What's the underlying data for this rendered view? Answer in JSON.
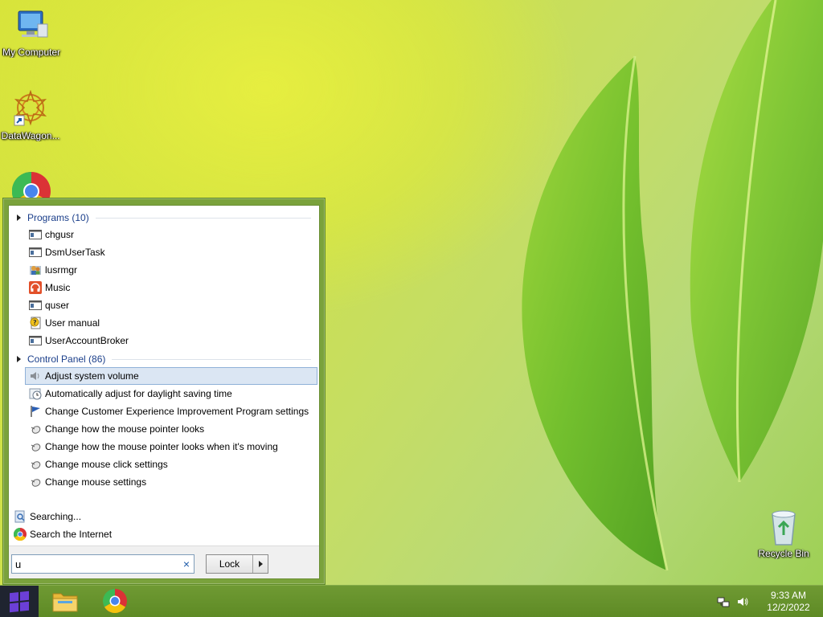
{
  "desktop": {
    "icons": [
      {
        "label": "My Computer",
        "icon": "computer-icon"
      },
      {
        "label": "DataWagon...",
        "icon": "datawagon-shortcut-icon"
      },
      {
        "label": "",
        "icon": "chrome-icon"
      },
      {
        "label": "Recycle Bin",
        "icon": "recycle-bin-icon"
      }
    ]
  },
  "start_menu": {
    "programs_header": "Programs (10)",
    "programs": [
      {
        "label": "chgusr",
        "icon": "console-app-icon"
      },
      {
        "label": "DsmUserTask",
        "icon": "console-app-icon"
      },
      {
        "label": "lusrmgr",
        "icon": "users-manager-icon"
      },
      {
        "label": "Music",
        "icon": "headphones-icon"
      },
      {
        "label": "quser",
        "icon": "console-app-icon"
      },
      {
        "label": "User manual",
        "icon": "help-document-icon"
      },
      {
        "label": "UserAccountBroker",
        "icon": "console-app-icon"
      }
    ],
    "control_panel_header": "Control Panel (86)",
    "control_panel": [
      {
        "label": "Adjust system volume",
        "icon": "speaker-icon",
        "selected": true
      },
      {
        "label": "Automatically adjust for daylight saving time",
        "icon": "clock-icon"
      },
      {
        "label": "Change Customer Experience Improvement Program settings",
        "icon": "flag-icon"
      },
      {
        "label": "Change how the mouse pointer looks",
        "icon": "mouse-icon"
      },
      {
        "label": "Change how the mouse pointer looks when it's moving",
        "icon": "mouse-icon"
      },
      {
        "label": "Change mouse click settings",
        "icon": "mouse-icon"
      },
      {
        "label": "Change mouse settings",
        "icon": "mouse-icon"
      }
    ],
    "searching_label": "Searching...",
    "search_internet_label": "Search the Internet",
    "search_value": "u",
    "clear_symbol": "×",
    "lock_label": "Lock"
  },
  "taskbar": {
    "apps": [
      {
        "name": "file-explorer-icon"
      },
      {
        "name": "chrome-icon"
      }
    ],
    "clock_time": "9:33 AM",
    "clock_date": "12/2/2022"
  },
  "colors": {
    "menu_frame": "#7aa23c",
    "taskbar": "#6f9a33",
    "header_text": "#1a3e8a",
    "selection": "#dbe6f3"
  }
}
